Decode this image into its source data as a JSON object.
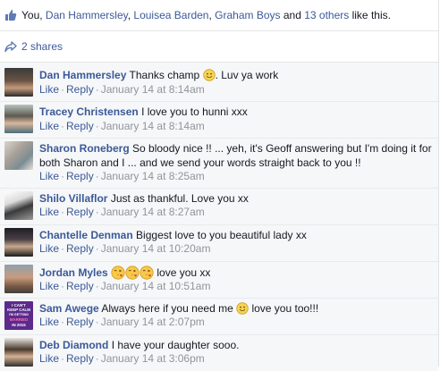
{
  "likes": {
    "prefix": "You, ",
    "names": [
      "Dan Hammersley",
      "Louisea Barden",
      "Graham Boys"
    ],
    "sep1": ", ",
    "sep2": ", ",
    "and_text": " and ",
    "others": "13 others",
    "suffix": " like this."
  },
  "shares": {
    "label": "2 shares"
  },
  "actions": {
    "like": "Like",
    "reply": "Reply",
    "dot": "·"
  },
  "comments": [
    {
      "name": "Dan Hammersley",
      "text_before": "Thanks champ ",
      "emoji": "smile",
      "text_after": ". Luv ya work",
      "time": "January 14 at 8:14am"
    },
    {
      "name": "Tracey Christensen",
      "text_before": "I love you to hunni xxx",
      "time": "January 14 at 8:14am"
    },
    {
      "name": "Sharon Roneberg",
      "text_before": "So bloody nice !! ... yeh, it's Geoff answering but I'm doing it for both Sharon and I ... and we send your words straight back to you !!",
      "time": "January 14 at 8:25am"
    },
    {
      "name": "Shilo Villaflor",
      "text_before": "Just as thankful. Love you xx",
      "time": "January 14 at 8:27am"
    },
    {
      "name": "Chantelle Denman",
      "text_before": "Biggest love to you beautiful lady xx",
      "time": "January 14 at 10:20am"
    },
    {
      "name": "Jordan Myles",
      "text_before": " love you xx",
      "emojis": [
        "kiss",
        "kiss",
        "kiss"
      ],
      "time": "January 14 at 10:51am"
    },
    {
      "name": "Sam Awege",
      "text_before": "Always here if you need me ",
      "emoji": "smile",
      "text_after": " love you too!!!",
      "time": "January 14 at 2:07pm",
      "avatar_text": [
        "I CAN'T",
        "KEEP CALM",
        "I'M GETTING",
        "MARRIED",
        "IN 2015"
      ]
    },
    {
      "name": "Deb Diamond",
      "text_before": "I have your daughter sooo.",
      "time": "January 14 at 3:06pm"
    }
  ],
  "colors": {
    "link": "#3b5998",
    "meta": "#90949c",
    "background": "#f6f7f8"
  }
}
